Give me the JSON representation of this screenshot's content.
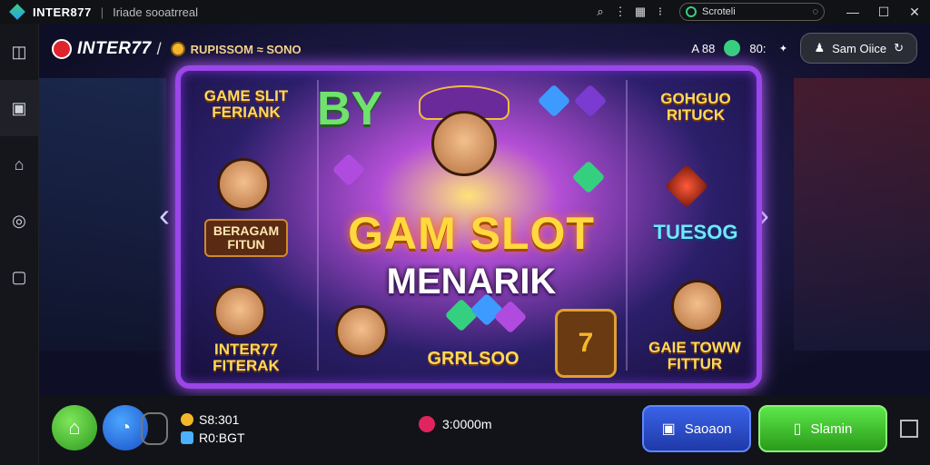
{
  "titlebar": {
    "app_name": "INTER877",
    "separator": "|",
    "subtitle": "Iriade sooatrreal",
    "search_value": "Scroteli",
    "min": "—",
    "max": "☐",
    "close": "✕"
  },
  "header": {
    "brand": "INTER77",
    "brand_slash": "/",
    "promo": "RUPISSOM ≈ SONO",
    "stat_1": "A 88",
    "stat_2": "80:",
    "user_label": "Sam Oiice"
  },
  "slot": {
    "by": "BY",
    "title_main": "GAM SLOT",
    "title_sub": "MENARIK",
    "tile_top_left": "GAME SLIT\nFERIANK",
    "tile_left_mid": "BERAGAM\nFITUN",
    "tile_left_bottom": "INTER77\nFITERAK",
    "tile_center_bottom": "GRRLSOO",
    "tile_top_right": "GOHGUO\nRITUCK",
    "tile_right_mid": "TUESOG",
    "tile_right_bottom": "GAIE TOWW\nFITTUR"
  },
  "bottombar": {
    "stat_top": "S8:301",
    "stat_bottom": "R0:BGT",
    "balance": "3:0000m",
    "button_blue": "Saoaon",
    "button_green": "Slamin"
  },
  "colors": {
    "accent_purple": "#9b46e8",
    "brand_red": "#e0242e",
    "button_green": "#2a9a1a",
    "button_blue": "#1f3aa8"
  }
}
